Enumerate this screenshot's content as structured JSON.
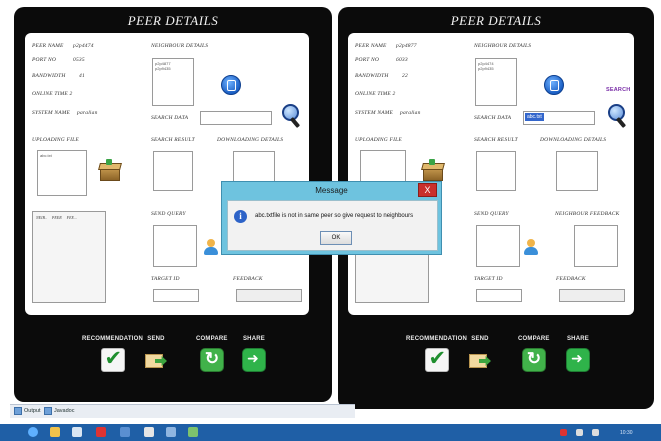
{
  "left_window": {
    "title": "PEER DETAILS",
    "peer_name_label": "PEER NAME",
    "peer_name_value": "p2p4474",
    "port_no_label": "PORT NO",
    "port_no_value": "0535",
    "bandwidth_label": "BANDWIDTH",
    "bandwidth_value": "41",
    "online_time_label": "ONLINE TIME 2",
    "system_name_label": "SYSTEM NAME",
    "system_name_value": "paralian",
    "neighbour_details_label": "NEIGHBOUR DETAILS",
    "neighbours": [
      "p2p4877",
      "p2p9435"
    ],
    "search_data_label": "SEARCH DATA",
    "search_data_value": "",
    "uploading_file_label": "UPLOADING FILE",
    "uploading_files": [
      "abc.txt"
    ],
    "search_result_label": "SEARCH RESULT",
    "downloading_details_label": "DOWNLOADING DETAILS",
    "table_headers": [
      "NEIB..",
      "PEER",
      "FEE..."
    ],
    "send_query_label": "SEND QUERY",
    "target_id_label": "TARGET ID",
    "feedback_label": "FEEDBACK"
  },
  "right_window": {
    "title": "PEER DETAILS",
    "peer_name_label": "PEER NAME",
    "peer_name_value": "p2p4877",
    "port_no_label": "PORT NO",
    "port_no_value": "6033",
    "bandwidth_label": "BANDWIDTH",
    "bandwidth_value": "22",
    "online_time_label": "ONLINE TIME 2",
    "system_name_label": "SYSTEM NAME",
    "system_name_value": "paralian",
    "neighbour_details_label": "NEIGHBOUR DETAILS",
    "neighbours": [
      "p2p4474",
      "p2p9435"
    ],
    "search_label": "SEARCH",
    "search_data_label": "SEARCH DATA",
    "search_data_value": "abc.txt",
    "uploading_file_label": "UPLOADING FILE",
    "search_result_label": "SEARCH RESULT",
    "downloading_details_label": "DOWNLOADING DETAILS",
    "send_query_label": "SEND QUERY",
    "neighbour_feedback_label": "NEIGHBOUR FEEDBACK",
    "target_id_label": "TARGET ID",
    "feedback_label": "FEEDBACK"
  },
  "toolbar": {
    "recommendation": "RECOMMENDATION",
    "send": "SEND",
    "compare": "COMPARE",
    "share": "SHARE"
  },
  "dialog": {
    "title": "Message",
    "message": "abc.txtfile is not in same peer so give request to neighbours",
    "ok": "OK",
    "close": "X"
  },
  "statusbar": {
    "tab1": "Output",
    "tab2": "Javadoc"
  },
  "taskbar": {
    "time": "10:30"
  },
  "colors": {
    "window_bg": "#0b0b0b",
    "dialog_title": "#6ec3df",
    "dialog_close": "#c9302c",
    "taskbar": "#1f5fa6",
    "search_highlight": "#3366cc"
  }
}
